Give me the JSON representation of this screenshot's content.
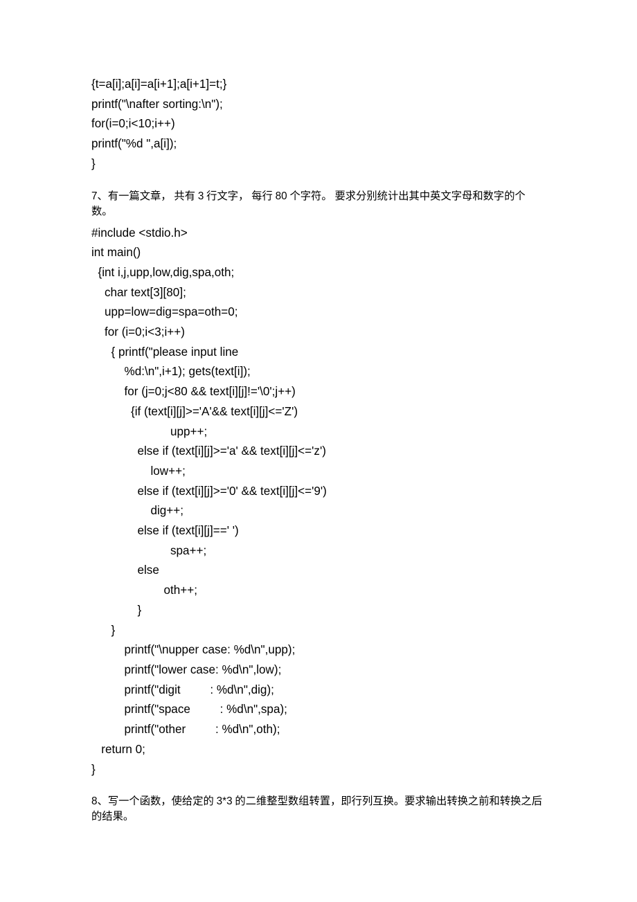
{
  "code1": {
    "l1": "{t=a[i];a[i]=a[i+1];a[i+1]=t;}",
    "l2": "printf(\"\\nafter sorting:\\n\");",
    "l3": "for(i=0;i<10;i++)",
    "l4": "printf(\"%d \",a[i]);",
    "l5": "}"
  },
  "q7": {
    "n": "7",
    "t1": "、有一篇文章， 共有 ",
    "n2": "3",
    "t2": " 行文字， 每行 ",
    "n3": "80",
    "t3": " 个字符。 要求分别统计出其中英文字母和数字的个数。"
  },
  "code2": {
    "l1": "#include <stdio.h>",
    "l2": "int main()",
    "l3": "  {int i,j,upp,low,dig,spa,oth;",
    "l4": "    char text[3][80];",
    "l5": "    upp=low=dig=spa=oth=0;",
    "l6": "    for (i=0;i<3;i++)",
    "l7": "      { printf(\"please input line",
    "l8": "          %d:\\n\",i+1); gets(text[i]);",
    "l9": "          for (j=0;j<80 && text[i][j]!='\\0';j++)",
    "l10": "            {if (text[i][j]>='A'&& text[i][j]<='Z')",
    "l11": "                        upp++;",
    "l12": "              else if (text[i][j]>='a' && text[i][j]<='z')",
    "l13": "                  low++;",
    "l14": "              else if (text[i][j]>='0' && text[i][j]<='9')",
    "l15": "                  dig++;",
    "l16": "              else if (text[i][j]==' ')",
    "l17": "                        spa++;",
    "l18": "              else",
    "l19": "                      oth++;",
    "l20": "              }",
    "l21": "      }",
    "l22": "          printf(\"\\nupper case: %d\\n\",upp);",
    "l23": "          printf(\"lower case: %d\\n\",low);",
    "l24": "          printf(\"digit         : %d\\n\",dig);",
    "l25": "          printf(\"space         : %d\\n\",spa);",
    "l26": "          printf(\"other         : %d\\n\",oth);",
    "l27": "   return 0;",
    "l28": "}"
  },
  "q8": {
    "n": "8",
    "t1": "、写一个函数，使给定的 ",
    "n2": "3*3",
    "t2": " 的二维整型数组转置，即行列互换。要求输出转换之前和转换之后的结果。"
  }
}
